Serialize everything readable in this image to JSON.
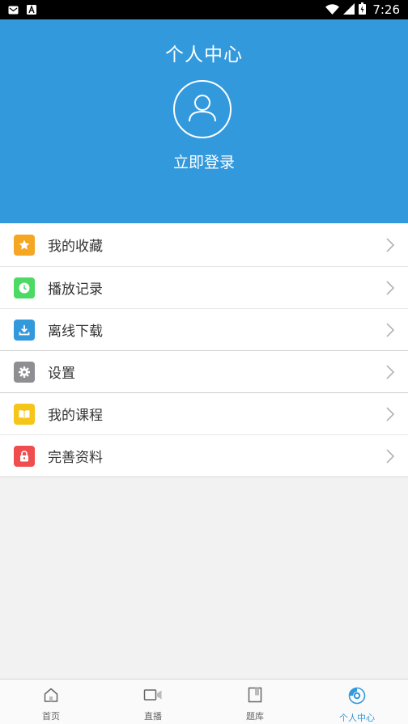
{
  "status_bar": {
    "time": "7:26",
    "icons": [
      "mail-icon",
      "app-notification-icon",
      "wifi-icon",
      "signal-icon",
      "battery-icon"
    ]
  },
  "header": {
    "title": "个人中心",
    "login_label": "立即登录",
    "avatar_icon": "user-avatar-icon",
    "background_color": "#3399dd"
  },
  "menu": {
    "items": [
      {
        "label": "我的收藏",
        "icon": "star-icon",
        "color": "#f5a623"
      },
      {
        "label": "播放记录",
        "icon": "clock-icon",
        "color": "#4cd964"
      },
      {
        "label": "离线下载",
        "icon": "download-icon",
        "color": "#3399dd"
      },
      {
        "label": "设置",
        "icon": "gear-icon",
        "color": "#8e8e93"
      },
      {
        "label": "我的课程",
        "icon": "book-icon",
        "color": "#f5c518"
      },
      {
        "label": "完善资料",
        "icon": "lock-icon",
        "color": "#f04e4e"
      }
    ]
  },
  "tabbar": {
    "active_color": "#3399dd",
    "tabs": [
      {
        "label": "首页",
        "icon": "home-icon",
        "active": false
      },
      {
        "label": "直播",
        "icon": "video-camera-icon",
        "active": false
      },
      {
        "label": "题库",
        "icon": "question-bank-icon",
        "active": false
      },
      {
        "label": "个人中心",
        "icon": "profile-disc-icon",
        "active": true
      }
    ]
  }
}
